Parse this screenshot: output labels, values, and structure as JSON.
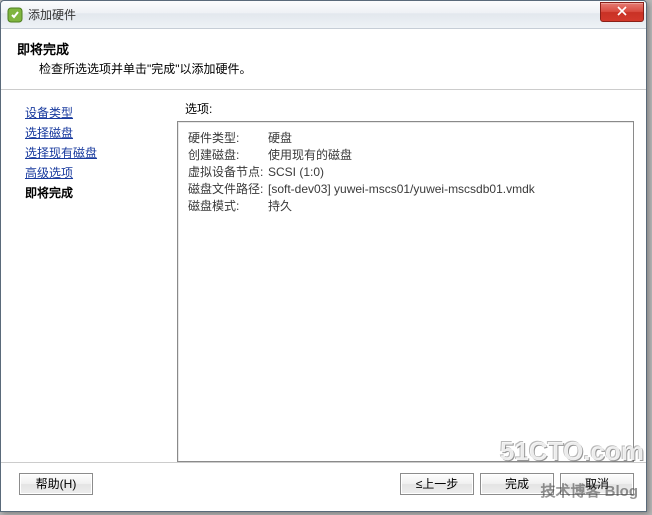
{
  "titlebar": {
    "title": "添加硬件"
  },
  "header": {
    "title": "即将完成",
    "subtitle": "检查所选选项并单击\"完成\"以添加硬件。"
  },
  "sidebar": {
    "items": [
      {
        "label": "设备类型"
      },
      {
        "label": "选择磁盘"
      },
      {
        "label": "选择现有磁盘"
      },
      {
        "label": "高级选项"
      }
    ],
    "current": "即将完成"
  },
  "content": {
    "options_label": "选项:",
    "rows": [
      {
        "label": "硬件类型:",
        "value": "硬盘"
      },
      {
        "label": "创建磁盘:",
        "value": "使用现有的磁盘"
      },
      {
        "label": "虚拟设备节点:",
        "value": "SCSI (1:0)"
      },
      {
        "label": "磁盘文件路径:",
        "value": "[soft-dev03] yuwei-mscs01/yuwei-mscsdb01.vmdk"
      },
      {
        "label": "磁盘模式:",
        "value": "持久"
      }
    ]
  },
  "footer": {
    "help": "帮助(H)",
    "back": "≤上一步",
    "finish": "完成",
    "cancel": "取消"
  },
  "watermark": {
    "main": "51CTO.com",
    "sub": "技术博客 Blog"
  }
}
